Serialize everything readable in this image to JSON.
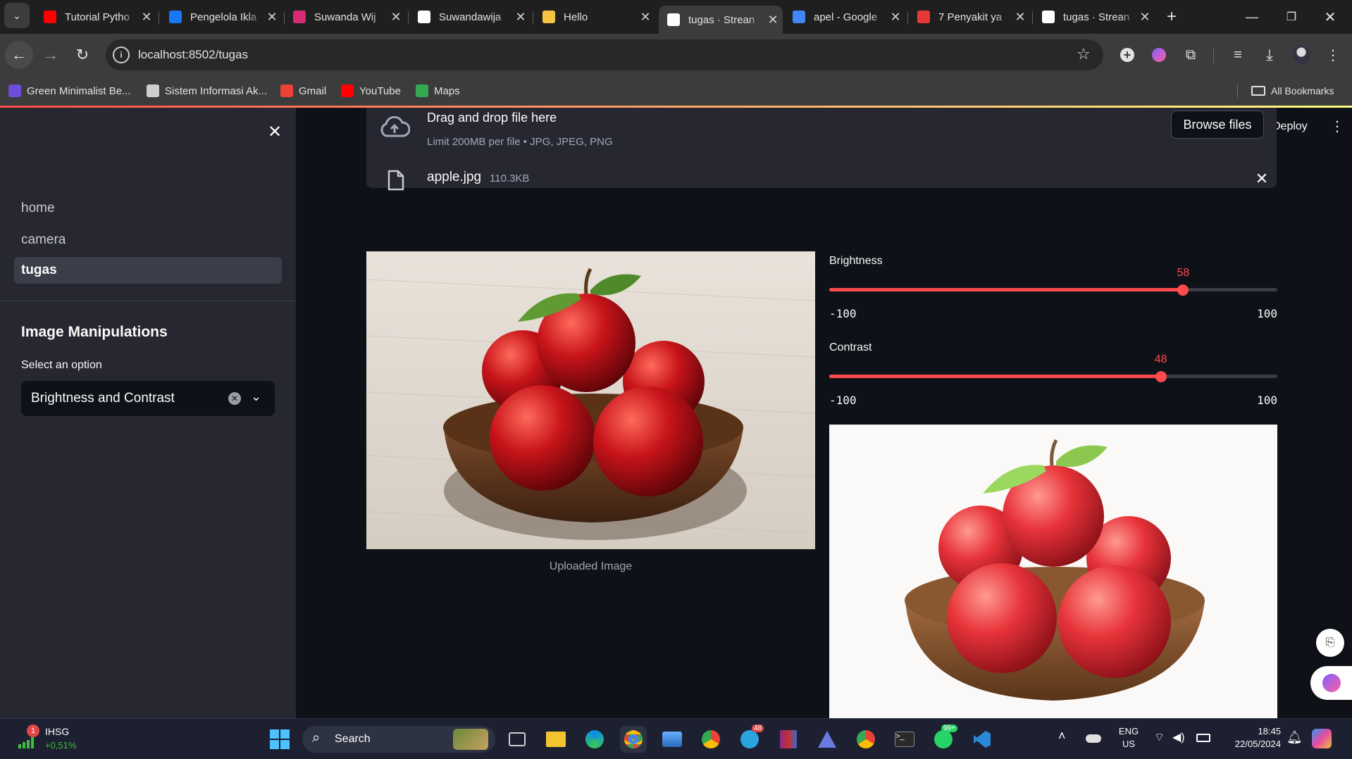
{
  "browser": {
    "tabs": [
      {
        "label": "Tutorial Pytho",
        "icon": "youtube-icon",
        "color": "#ff0000",
        "active": false
      },
      {
        "label": "Pengelola Ikla",
        "icon": "meta-icon",
        "color": "#1877f2",
        "active": false
      },
      {
        "label": "Suwanda Wij",
        "icon": "instagram-icon",
        "color": "#d62976",
        "active": false
      },
      {
        "label": "Suwandawija",
        "icon": "github-icon",
        "color": "#ffffff",
        "active": false
      },
      {
        "label": "Hello",
        "icon": "waving-hand-icon",
        "color": "#f5c542",
        "active": false
      },
      {
        "label": "tugas · Strean",
        "icon": "streamlit-icon",
        "color": "#ffffff",
        "active": true
      },
      {
        "label": "apel - Google",
        "icon": "google-icon",
        "color": "#4285f4",
        "active": false
      },
      {
        "label": "7 Penyakit ya",
        "icon": "site-icon",
        "color": "#e53935",
        "active": false
      },
      {
        "label": "tugas · Strean",
        "icon": "streamlit-icon",
        "color": "#ffffff",
        "active": false
      }
    ],
    "url": "localhost:8502/tugas",
    "bookmarks": [
      {
        "label": "Green Minimalist Be...",
        "icon": "canva-icon",
        "color": "#6e4bd8"
      },
      {
        "label": "Sistem Informasi Ak...",
        "icon": "globe-icon",
        "color": "#cfcfcf"
      },
      {
        "label": "Gmail",
        "icon": "gmail-icon",
        "color": "#ea4335"
      },
      {
        "label": "YouTube",
        "icon": "youtube-icon",
        "color": "#ff0000"
      },
      {
        "label": "Maps",
        "icon": "maps-icon",
        "color": "#34a853"
      }
    ],
    "all_bookmarks": "All Bookmarks"
  },
  "header": {
    "deploy": "Deploy"
  },
  "sidebar": {
    "nav": [
      {
        "label": "home",
        "active": false
      },
      {
        "label": "camera",
        "active": false
      },
      {
        "label": "tugas",
        "active": true
      }
    ],
    "section_title": "Image Manipulations",
    "select_label": "Select an option",
    "select_value": "Brightness and Contrast"
  },
  "uploader": {
    "drop_text": "Drag and drop file here",
    "limit_text": "Limit 200MB per file • JPG, JPEG, PNG",
    "browse_label": "Browse files",
    "file_name": "apple.jpg",
    "file_size": "110.3KB"
  },
  "uploaded_caption": "Uploaded Image",
  "controls": {
    "brightness": {
      "label": "Brightness",
      "value": 58,
      "min": -100,
      "max": 100,
      "min_label": "-100",
      "max_label": "100",
      "value_label": "58"
    },
    "contrast": {
      "label": "Contrast",
      "value": 48,
      "min": -100,
      "max": 100,
      "min_label": "-100",
      "max_label": "100",
      "value_label": "48"
    }
  },
  "colors": {
    "accent": "#ff4b4b",
    "sidebar_bg": "#262730",
    "main_bg": "#0e1117"
  },
  "taskbar": {
    "stock_name": "IHSG",
    "stock_change": "+0,51%",
    "stock_badge": "1",
    "search_placeholder": "Search",
    "telegram_badge": "48",
    "whatsapp_badge": "99+",
    "lang_top": "ENG",
    "lang_bottom": "US",
    "time": "18:45",
    "date": "22/05/2024"
  }
}
